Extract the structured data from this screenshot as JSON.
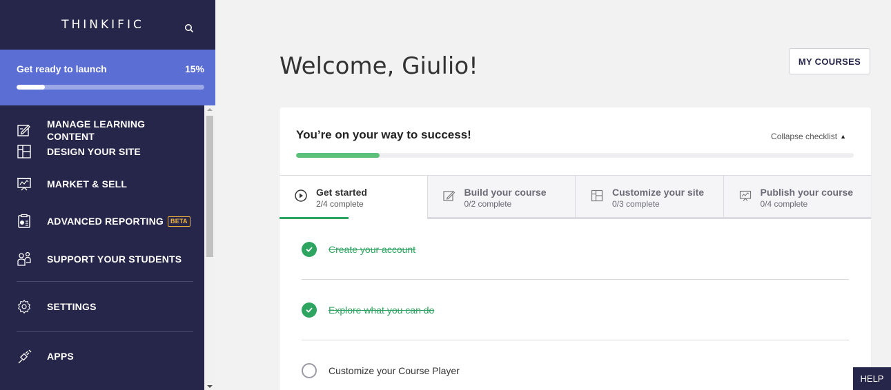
{
  "brand": {
    "name": "THINKIFIC",
    "search_icon": "search-icon"
  },
  "launch": {
    "label": "Get ready to launch",
    "percent_text": "15%",
    "progress": 0.15
  },
  "sidebar": {
    "items": [
      {
        "label": "MANAGE LEARNING CONTENT",
        "icon": "edit-content-icon"
      },
      {
        "label": "DESIGN YOUR SITE",
        "icon": "layout-icon"
      },
      {
        "label": "MARKET & SELL",
        "icon": "presentation-chart-icon"
      },
      {
        "label": "ADVANCED REPORTING",
        "badge": "BETA",
        "icon": "report-icon"
      },
      {
        "label": "SUPPORT YOUR STUDENTS",
        "icon": "students-icon"
      },
      {
        "label": "SETTINGS",
        "icon": "gear-icon"
      },
      {
        "label": "APPS",
        "icon": "plug-icon"
      }
    ]
  },
  "header": {
    "title": "Welcome, Giulio!",
    "my_courses": "MY COURSES"
  },
  "checklist": {
    "heading": "You’re on your way to success!",
    "collapse_label": "Collapse checklist",
    "progress": 0.15,
    "tabs": [
      {
        "title": "Get started",
        "sub": "2/4 complete",
        "icon": "play-circle-icon",
        "active": true,
        "progress": 0.5
      },
      {
        "title": "Build your course",
        "sub": "0/2 complete",
        "icon": "edit-content-icon"
      },
      {
        "title": "Customize your site",
        "sub": "0/3 complete",
        "icon": "layout-icon"
      },
      {
        "title": "Publish your course",
        "sub": "0/4 complete",
        "icon": "presentation-chart-icon"
      }
    ],
    "tasks": [
      {
        "label": "Create your account",
        "done": true
      },
      {
        "label": "Explore what you can do",
        "done": true
      },
      {
        "label": "Customize your Course Player",
        "done": false
      }
    ]
  },
  "help": {
    "label": "HELP"
  },
  "colors": {
    "sidebar": "#26254a",
    "launch": "#5b6ed4",
    "success": "#2da45f",
    "progress": "#5cc178"
  }
}
